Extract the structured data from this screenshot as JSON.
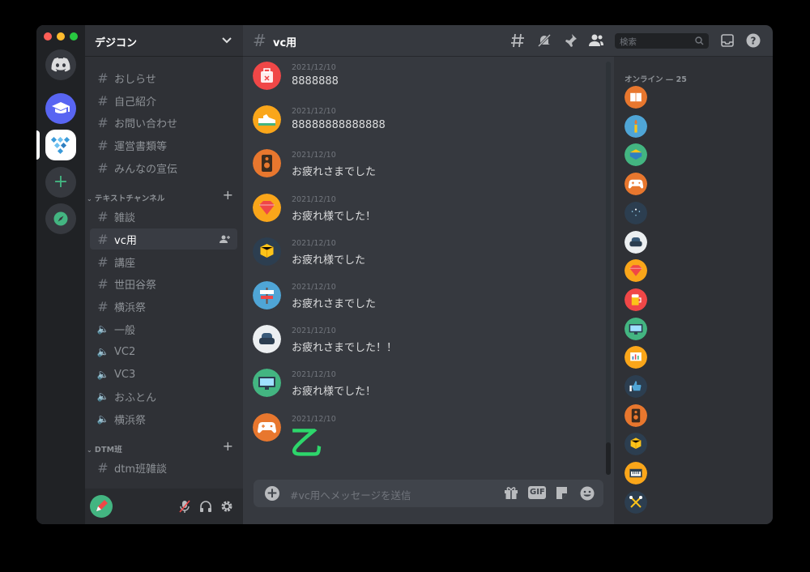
{
  "server": {
    "name": "デジコン"
  },
  "channels_top": [
    {
      "label": "おしらせ"
    },
    {
      "label": "自己紹介"
    },
    {
      "label": "お問い合わせ"
    },
    {
      "label": "運営書類等"
    },
    {
      "label": "みんなの宣伝"
    }
  ],
  "category_text": {
    "label": "テキストチャンネル"
  },
  "channels_text": [
    {
      "label": "雑談"
    },
    {
      "label": "vc用"
    },
    {
      "label": "講座"
    },
    {
      "label": "世田谷祭"
    },
    {
      "label": "横浜祭"
    }
  ],
  "channels_voice": [
    {
      "label": "一般"
    },
    {
      "label": "VC2"
    },
    {
      "label": "VC3"
    },
    {
      "label": "おふとん"
    },
    {
      "label": "横浜祭"
    }
  ],
  "category_dtm": {
    "label": "DTM班"
  },
  "channels_dtm": [
    {
      "label": "dtm班雑談"
    }
  ],
  "topbar": {
    "channel": "vc用",
    "search_placeholder": "検索"
  },
  "messages": [
    {
      "timestamp": "2021/12/10",
      "text": "8888888",
      "avatar_color": "#f04747",
      "icon": "suitcase-icon"
    },
    {
      "timestamp": "2021/12/10",
      "text": "88888888888888",
      "avatar_color": "#faa61a",
      "icon": "sneaker-icon"
    },
    {
      "timestamp": "2021/12/10",
      "text": "お疲れさまでした",
      "avatar_color": "#e8772e",
      "icon": "speaker-icon"
    },
    {
      "timestamp": "2021/12/10",
      "text": "お疲れ様でした！",
      "avatar_color": "#faa61a",
      "icon": "gem-icon"
    },
    {
      "timestamp": "2021/12/10",
      "text": "お疲れ様でした",
      "avatar_color": "#2c3e50",
      "icon": "box-icon"
    },
    {
      "timestamp": "2021/12/10",
      "text": "お疲れさまでした",
      "avatar_color": "#4fa5d6",
      "icon": "signpost-icon"
    },
    {
      "timestamp": "2021/12/10",
      "text": "お疲れさまでした！！",
      "avatar_color": "#eceff1",
      "icon": "armchair-icon"
    },
    {
      "timestamp": "2021/12/10",
      "text": "お疲れ様でした！",
      "avatar_color": "#43b581",
      "icon": "monitor-icon"
    },
    {
      "timestamp": "2021/12/10",
      "text": "",
      "avatar_color": "#e8772e",
      "icon": "gamepad-icon"
    }
  ],
  "sticker": {
    "label": "乙",
    "color": "#2dd66b"
  },
  "composer": {
    "placeholder": "#vc用へメッセージを送信",
    "gif_label": "GIF"
  },
  "members": {
    "header": "オンライン — 25",
    "avatars": [
      {
        "color": "#e8772e",
        "icon": "book-icon"
      },
      {
        "color": "#4fa5d6",
        "icon": "candle-icon"
      },
      {
        "color": "#43b581",
        "icon": "cake-icon"
      },
      {
        "color": "#e8772e",
        "icon": "gamepad-icon"
      },
      {
        "color": "#2c3e50",
        "icon": "sparkle-icon"
      },
      {
        "color": "#eceff1",
        "icon": "armchair-icon"
      },
      {
        "color": "#faa61a",
        "icon": "gem-icon"
      },
      {
        "color": "#f04747",
        "icon": "beer-icon"
      },
      {
        "color": "#43b581",
        "icon": "monitor-icon"
      },
      {
        "color": "#faa61a",
        "icon": "chart-icon"
      },
      {
        "color": "#2c3e50",
        "icon": "thumbs-up-icon"
      },
      {
        "color": "#e8772e",
        "icon": "speaker-icon"
      },
      {
        "color": "#2c3e50",
        "icon": "box-icon"
      },
      {
        "color": "#faa61a",
        "icon": "keyboard-icon"
      },
      {
        "color": "#2c3e50",
        "icon": "tools-icon"
      }
    ]
  },
  "colors": {
    "accent": "#5865f2",
    "green": "#43b581"
  }
}
